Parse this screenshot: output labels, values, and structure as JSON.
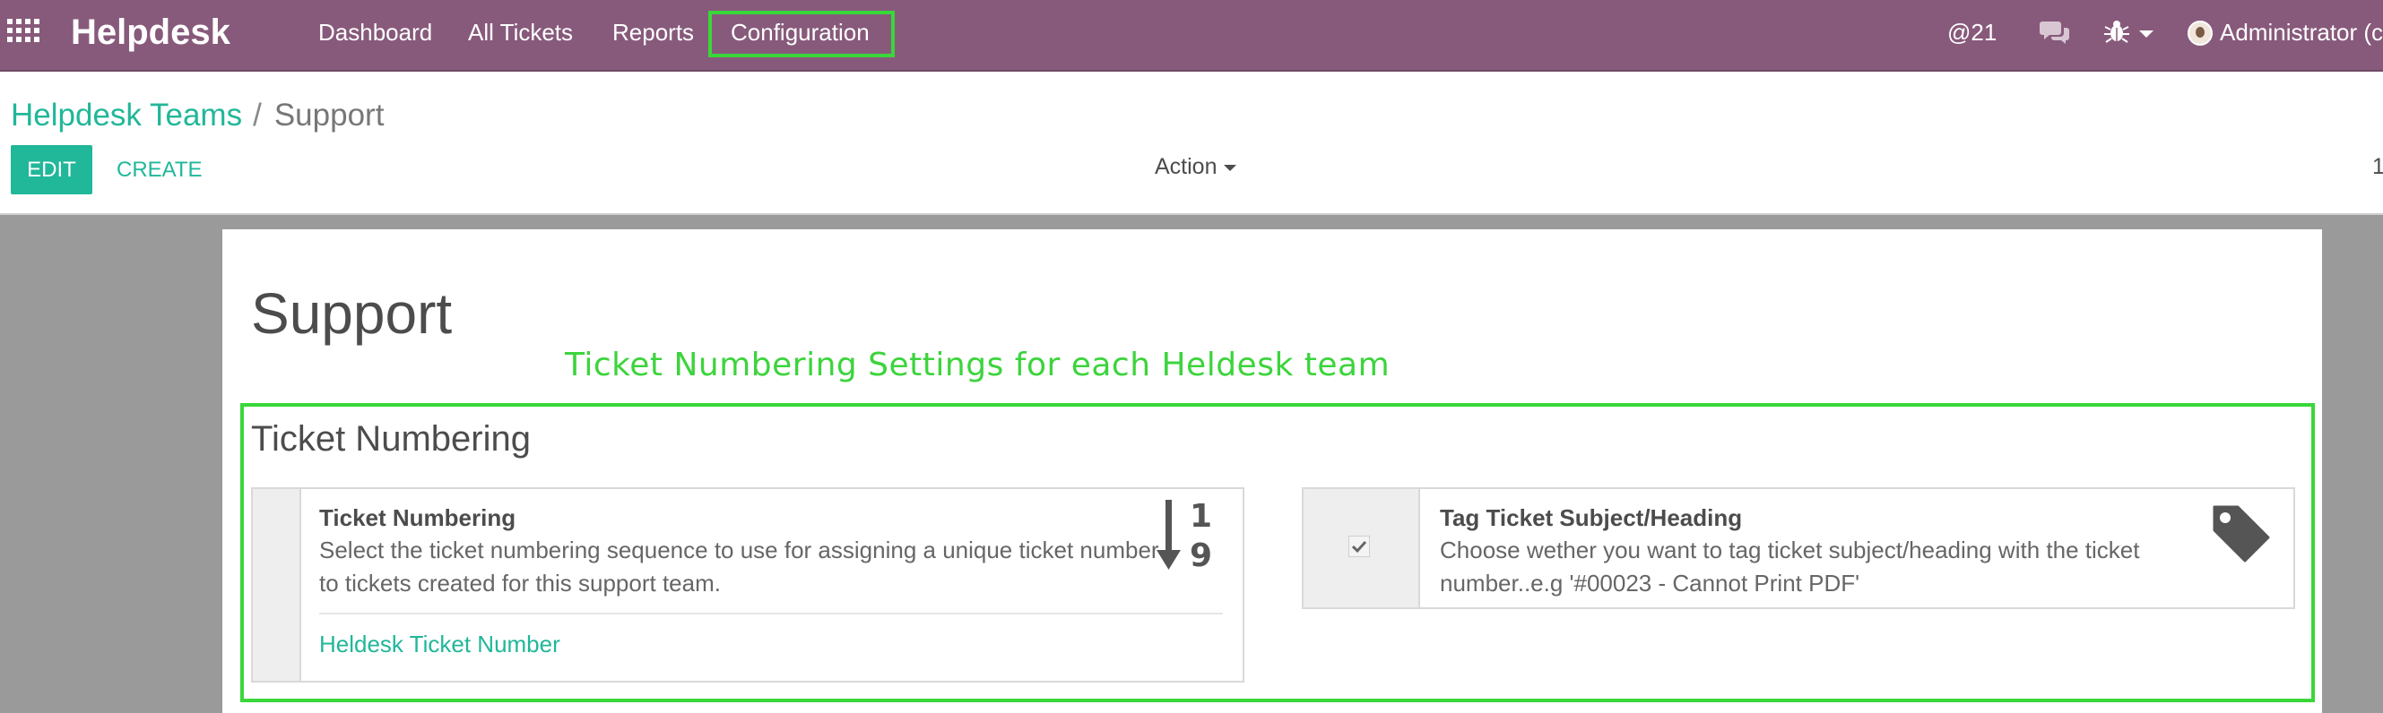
{
  "navbar": {
    "apps_icon": "apps-grid-icon",
    "brand": "Helpdesk",
    "menu": [
      "Dashboard",
      "All Tickets",
      "Reports",
      "Configuration"
    ],
    "mentions": "@21",
    "chat_icon": "chat-bubbles-icon",
    "debug_icon": "bug-icon",
    "user": "Administrator (c",
    "colors": {
      "bar": "#875a7b",
      "highlight": "#39d739"
    }
  },
  "breadcrumb": {
    "parent": "Helpdesk Teams",
    "separator": "/",
    "current": "Support"
  },
  "buttons": {
    "edit": "EDIT",
    "create": "CREATE"
  },
  "action": {
    "label": "Action"
  },
  "pager": {
    "text": "1"
  },
  "form": {
    "title": "Support",
    "annotation": "Ticket Numbering Settings for each Heldesk team",
    "section_title": "Ticket Numbering",
    "settings": [
      {
        "heading": "Ticket Numbering",
        "description": "Select the ticket numbering sequence to use for assigning a unique ticket number to tickets created for this support team.",
        "link": "Heldesk Ticket Number",
        "icon": "sort-numeric-down-icon"
      },
      {
        "heading": "Tag Ticket Subject/Heading",
        "description": "Choose wether you want to tag ticket subject/heading with the ticket number..e.g '#00023 - Cannot Print PDF'",
        "checked": true,
        "icon": "tag-icon"
      }
    ]
  },
  "colors": {
    "accent": "#21b799",
    "annotation": "#3cd43c"
  }
}
